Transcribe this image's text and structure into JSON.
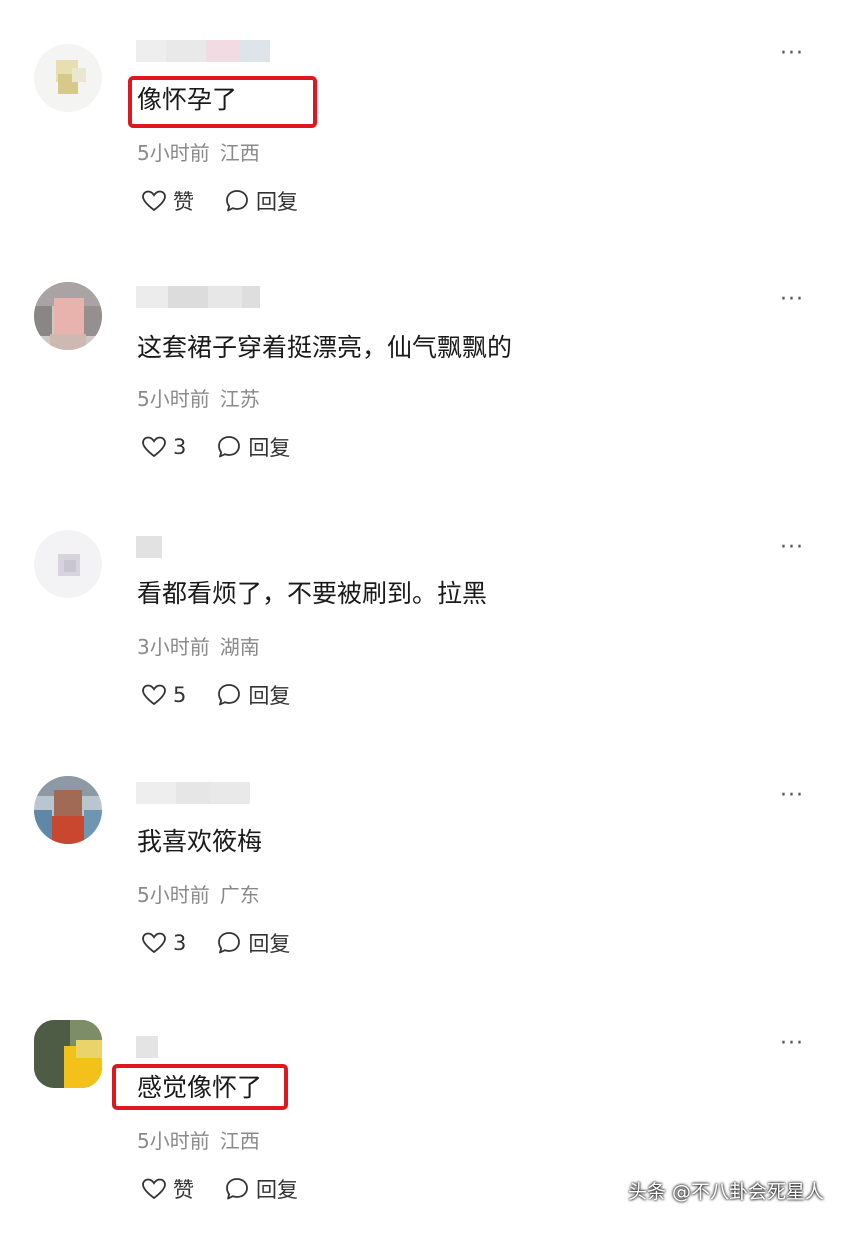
{
  "comments": [
    {
      "text": "像怀孕了",
      "time": "5小时前",
      "location": "江西",
      "like": "赞",
      "reply": "回复",
      "more": "···",
      "highlighted": true
    },
    {
      "text": "这套裙子穿着挺漂亮，仙气飘飘的",
      "time": "5小时前",
      "location": "江苏",
      "like": "3",
      "reply": "回复",
      "more": "···",
      "highlighted": false
    },
    {
      "text": "看都看烦了，不要被刷到。拉黑",
      "time": "3小时前",
      "location": "湖南",
      "like": "5",
      "reply": "回复",
      "more": "···",
      "highlighted": false
    },
    {
      "text": "我喜欢筱梅",
      "time": "5小时前",
      "location": "广东",
      "like": "3",
      "reply": "回复",
      "more": "···",
      "highlighted": false
    },
    {
      "text": "感觉像怀了",
      "time": "5小时前",
      "location": "江西",
      "like": "赞",
      "reply": "回复",
      "more": "···",
      "highlighted": true
    }
  ],
  "watermark": "头条 @不八卦会死星人",
  "colors": {
    "highlight": "#e0171f",
    "meta": "#8a8a8a",
    "text": "#1a1a1a"
  },
  "icons": {
    "like": "heart-icon",
    "reply": "speech-bubble-icon",
    "more": "more-dots-icon"
  }
}
